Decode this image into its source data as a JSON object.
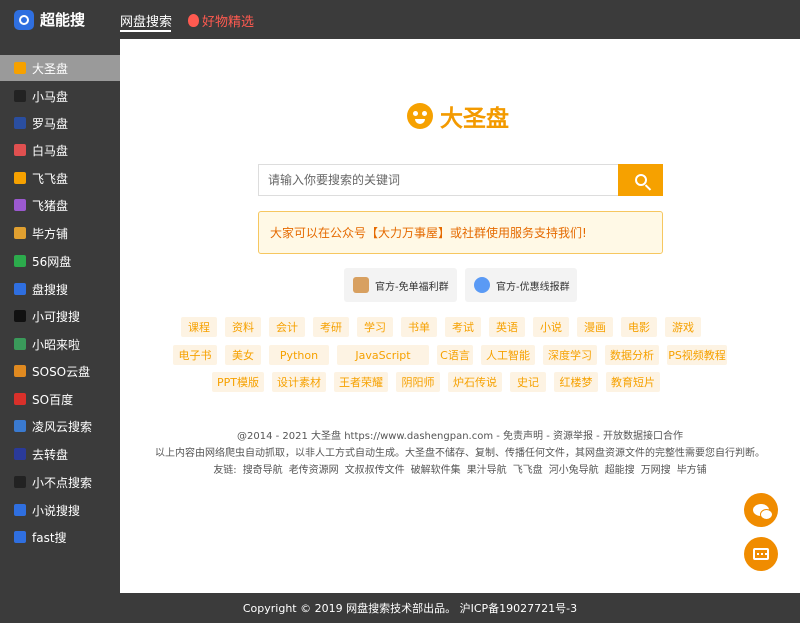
{
  "header": {
    "logo_text": "超能搜",
    "tabs": [
      {
        "label": "网盘搜索",
        "active": true
      },
      {
        "label": "好物精选",
        "active": false
      }
    ]
  },
  "sidebar": {
    "items": [
      {
        "label": "大圣盘",
        "icon": "monkey-icon",
        "color": "#f6a100",
        "active": true
      },
      {
        "label": "小马盘",
        "icon": "horse-icon",
        "color": "#222222"
      },
      {
        "label": "罗马盘",
        "icon": "roman-icon",
        "color": "#2a4ea0"
      },
      {
        "label": "白马盘",
        "icon": "white-horse-icon",
        "color": "#e05050"
      },
      {
        "label": "飞飞盘",
        "icon": "paper-plane-icon",
        "color": "#f6a100"
      },
      {
        "label": "飞猪盘",
        "icon": "pig-icon",
        "color": "#9b59d0"
      },
      {
        "label": "毕方铺",
        "icon": "bird-icon",
        "color": "#e0a030"
      },
      {
        "label": "56网盘",
        "icon": "search-q-icon",
        "color": "#2cab4c"
      },
      {
        "label": "盘搜搜",
        "icon": "disk-icon",
        "color": "#2f6fe0"
      },
      {
        "label": "小可搜搜",
        "icon": "xiaoke-icon",
        "color": "#111111"
      },
      {
        "label": "小昭来啦",
        "icon": "xiaozhao-icon",
        "color": "#3a9a5a"
      },
      {
        "label": "SOSO云盘",
        "icon": "soso-icon",
        "color": "#e08a20"
      },
      {
        "label": "SO百度",
        "icon": "so-icon",
        "color": "#d9302a"
      },
      {
        "label": "凌风云搜索",
        "icon": "wind-icon",
        "color": "#3a7ad0"
      },
      {
        "label": "去转盘",
        "icon": "qu-icon",
        "color": "#2a3a9a"
      },
      {
        "label": "小不点搜索",
        "icon": "dot-icon",
        "color": "#222222"
      },
      {
        "label": "小说搜搜",
        "icon": "book-icon",
        "color": "#2f6fe0"
      },
      {
        "label": "fast搜",
        "icon": "fast-icon",
        "color": "#2f6fe0"
      }
    ]
  },
  "main": {
    "brand": "大圣盘",
    "search": {
      "placeholder": "请输入你要搜索的关键词"
    },
    "notice": "大家可以在公众号【大力万事屋】或社群使用服务支持我们!",
    "groups": [
      {
        "label": "官方-免单福利群"
      },
      {
        "label": "官方-优惠线报群"
      }
    ],
    "tags": [
      [
        "课程",
        "资料",
        "会计",
        "考研",
        "学习",
        "书单",
        "考试",
        "英语",
        "小说",
        "漫画",
        "电影",
        "游戏"
      ],
      [
        "电子书",
        "美女",
        "Python",
        "JavaScript",
        "C语言",
        "人工智能",
        "深度学习",
        "数据分析",
        "PS视频教程"
      ],
      [
        "PPT模版",
        "设计素材",
        "王者荣耀",
        "阴阳师",
        "炉石传说",
        "史记",
        "红楼梦",
        "教育短片"
      ]
    ],
    "copyright_line": "@2014 - 2021 大圣盘 https://www.dashengpan.com - 免责声明 - 资源举报 - 开放数据接口合作",
    "disclaimer": "以上内容由网络爬虫自动抓取，以非人工方式自动生成。大圣盘不储存、复制、传播任何文件，其网盘资源文件的完整性需要您自行判断。",
    "friends_label": "友链:",
    "friends": [
      "搜奇导航",
      "老传资源网",
      "文叔叔传文件",
      "破解软件集",
      "果汁导航",
      "飞飞盘",
      "河小兔导航",
      "超能搜",
      "万网搜",
      "毕方铺"
    ]
  },
  "footer": {
    "text": "Copyright © 2019 网盘搜索技术部出品。 沪ICP备19027721号-3"
  },
  "colors": {
    "accent": "#f6a100",
    "dark": "#3b3b3b"
  }
}
